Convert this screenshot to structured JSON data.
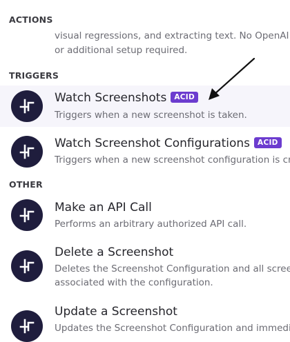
{
  "sections": {
    "actions": "ACTIONS",
    "triggers": "TRIGGERS",
    "other": "OTHER"
  },
  "actions_desc": {
    "line1": "visual regressions, and extracting text. No OpenAI k",
    "line2": "or additional setup required."
  },
  "triggers": [
    {
      "title": "Watch Screenshots",
      "badge": "ACID",
      "desc": "Triggers when a new screenshot is taken."
    },
    {
      "title": "Watch Screenshot Configurations",
      "badge": "ACID",
      "desc": "Triggers when a new screenshot configuration is cr"
    }
  ],
  "other": [
    {
      "title": "Make an API Call",
      "desc1": "Performs an arbitrary authorized API call."
    },
    {
      "title": "Delete a Screenshot",
      "desc1": "Deletes the Screenshot Configuration and all screen",
      "desc2": "associated with the configuration."
    },
    {
      "title": "Update a Screenshot",
      "desc1": "Updates the Screenshot Configuration and immedia"
    }
  ],
  "icons": {
    "app": "app-logo-icon",
    "annotation": "arrow-annotation-icon"
  },
  "colors": {
    "badge": "#6c3ccf",
    "icon_bg": "#1f1d3d",
    "highlight": "#f6f5fb"
  }
}
